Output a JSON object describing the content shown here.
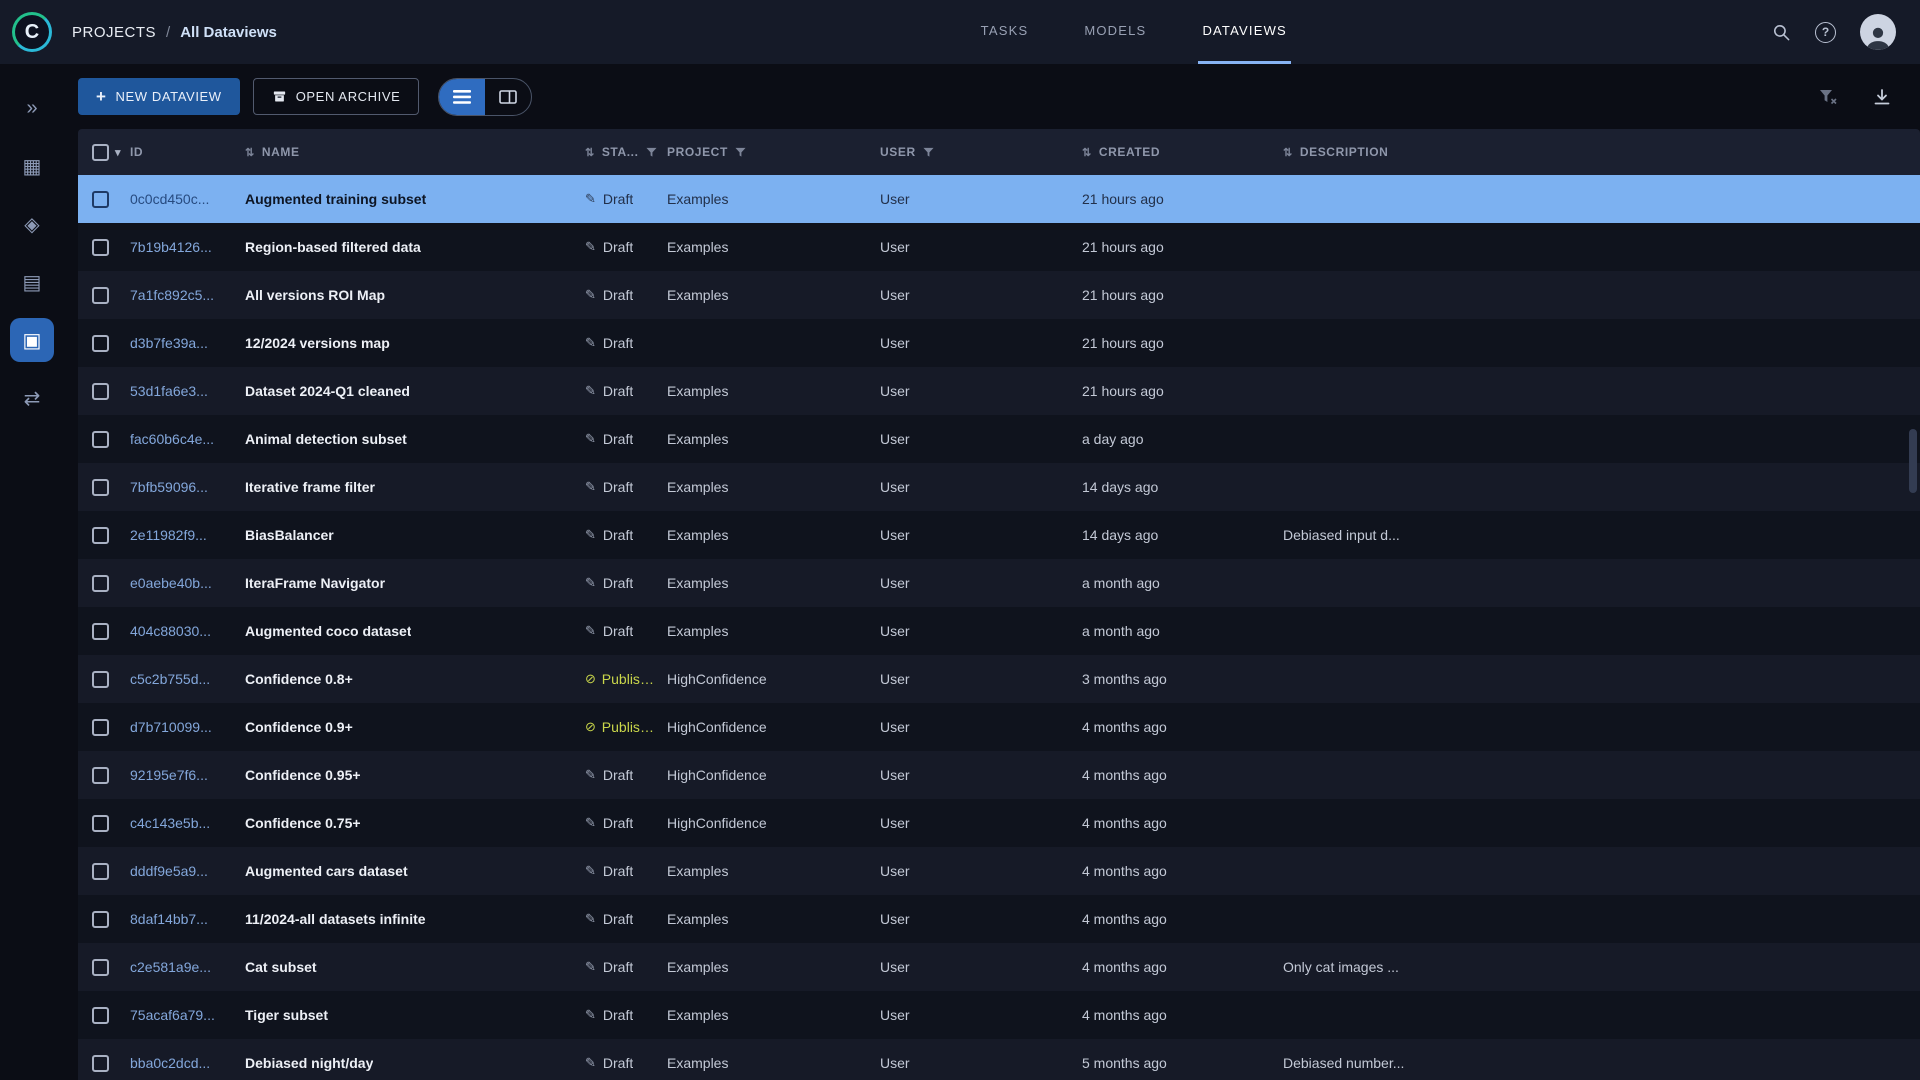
{
  "brand": {
    "logo_letter": "C"
  },
  "header": {
    "breadcrumb": {
      "root": "PROJECTS",
      "separator": "/",
      "current": "All Dataviews"
    },
    "tabs": [
      {
        "label": "TASKS",
        "active": false
      },
      {
        "label": "MODELS",
        "active": false
      },
      {
        "label": "DATAVIEWS",
        "active": true
      }
    ],
    "help_glyph": "?"
  },
  "sidebar": {
    "items": [
      {
        "name": "getting-started",
        "glyph": "»",
        "active": false
      },
      {
        "name": "datasets",
        "glyph": "▦",
        "active": false
      },
      {
        "name": "pipelines",
        "glyph": "◈",
        "active": false
      },
      {
        "name": "reports",
        "glyph": "▤",
        "active": false
      },
      {
        "name": "dataviews",
        "glyph": "▣",
        "active": true
      },
      {
        "name": "workers-queues",
        "glyph": "⇄",
        "active": false
      }
    ]
  },
  "toolbar": {
    "plus": "+",
    "new_dataview_label": "NEW DATAVIEW",
    "open_archive_label": "OPEN ARCHIVE"
  },
  "table": {
    "sort_glyph": "⇅",
    "caret_glyph": "▾",
    "status_icons": {
      "draft": "✎",
      "published": "⊘"
    },
    "columns": [
      {
        "key": "checkbox",
        "label": ""
      },
      {
        "key": "id",
        "label": "ID"
      },
      {
        "key": "name",
        "label": "NAME",
        "sort": true
      },
      {
        "key": "status",
        "label": "STA...",
        "sort": true,
        "filter": true
      },
      {
        "key": "project",
        "label": "PROJECT",
        "filter": true
      },
      {
        "key": "user",
        "label": "USER",
        "filter": true
      },
      {
        "key": "created",
        "label": "CREATED",
        "sort": true
      },
      {
        "key": "description",
        "label": "DESCRIPTION",
        "sort": true
      }
    ],
    "rows": [
      {
        "id": "0c0cd450c...",
        "name": "Augmented training subset",
        "status": "Draft",
        "project": "Examples",
        "user": "User",
        "created": "21 hours ago",
        "description": "",
        "selected": true
      },
      {
        "id": "7b19b4126...",
        "name": "Region-based filtered data",
        "status": "Draft",
        "project": "Examples",
        "user": "User",
        "created": "21 hours ago",
        "description": ""
      },
      {
        "id": "7a1fc892c5...",
        "name": "All versions ROI Map",
        "status": "Draft",
        "project": "Examples",
        "user": "User",
        "created": "21 hours ago",
        "description": ""
      },
      {
        "id": "d3b7fe39a...",
        "name": "12/2024 versions map",
        "status": "Draft",
        "project": "",
        "user": "User",
        "created": "21 hours ago",
        "description": ""
      },
      {
        "id": "53d1fa6e3...",
        "name": "Dataset 2024-Q1 cleaned",
        "status": "Draft",
        "project": "Examples",
        "user": "User",
        "created": "21 hours ago",
        "description": ""
      },
      {
        "id": "fac60b6c4e...",
        "name": "Animal detection subset",
        "status": "Draft",
        "project": "Examples",
        "user": "User",
        "created": "a day ago",
        "description": ""
      },
      {
        "id": "7bfb59096...",
        "name": "Iterative frame filter",
        "status": "Draft",
        "project": "Examples",
        "user": "User",
        "created": "14 days ago",
        "description": ""
      },
      {
        "id": "2e11982f9...",
        "name": "BiasBalancer",
        "status": "Draft",
        "project": "Examples",
        "user": "User",
        "created": "14 days ago",
        "description": "Debiased input d..."
      },
      {
        "id": "e0aebe40b...",
        "name": "IteraFrame Navigator",
        "status": "Draft",
        "project": "Examples",
        "user": "User",
        "created": "a month ago",
        "description": ""
      },
      {
        "id": "404c88030...",
        "name": "Augmented coco dataset",
        "status": "Draft",
        "project": "Examples",
        "user": "User",
        "created": "a month ago",
        "description": ""
      },
      {
        "id": "c5c2b755d...",
        "name": "Confidence 0.8+",
        "status": "Published",
        "project": "HighConfidence",
        "user": "User",
        "created": "3 months ago",
        "description": ""
      },
      {
        "id": "d7b710099...",
        "name": "Confidence 0.9+",
        "status": "Published",
        "project": "HighConfidence",
        "user": "User",
        "created": "4 months ago",
        "description": ""
      },
      {
        "id": "92195e7f6...",
        "name": "Confidence 0.95+",
        "status": "Draft",
        "project": "HighConfidence",
        "user": "User",
        "created": "4 months ago",
        "description": ""
      },
      {
        "id": "c4c143e5b...",
        "name": "Confidence 0.75+",
        "status": "Draft",
        "project": "HighConfidence",
        "user": "User",
        "created": "4 months ago",
        "description": ""
      },
      {
        "id": "dddf9e5a9...",
        "name": "Augmented cars dataset",
        "status": "Draft",
        "project": "Examples",
        "user": "User",
        "created": "4 months ago",
        "description": ""
      },
      {
        "id": "8daf14bb7...",
        "name": "11/2024-all datasets infinite",
        "status": "Draft",
        "project": "Examples",
        "user": "User",
        "created": "4 months ago",
        "description": ""
      },
      {
        "id": "c2e581a9e...",
        "name": "Cat subset",
        "status": "Draft",
        "project": "Examples",
        "user": "User",
        "created": "4 months ago",
        "description": "Only cat images ..."
      },
      {
        "id": "75acaf6a79...",
        "name": "Tiger subset",
        "status": "Draft",
        "project": "Examples",
        "user": "User",
        "created": "4 months ago",
        "description": ""
      },
      {
        "id": "bba0c2dcd...",
        "name": "Debiased night/day",
        "status": "Draft",
        "project": "Examples",
        "user": "User",
        "created": "5 months ago",
        "description": "Debiased number..."
      }
    ]
  },
  "colors": {
    "accent_blue": "#2f6cc0",
    "selected_row": "#7cb1f1",
    "published_green": "#c9d64a",
    "primary_button": "#1f579c"
  }
}
